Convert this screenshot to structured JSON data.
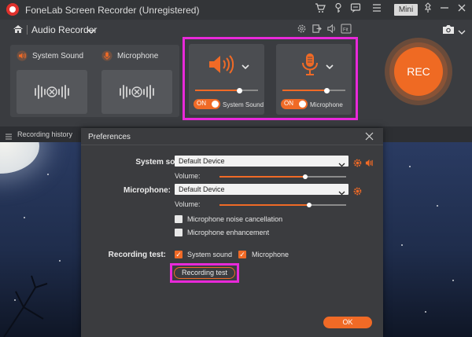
{
  "titlebar": {
    "app_title": "FoneLab Screen Recorder (Unregistered)",
    "mini_label": "Mini",
    "icons": [
      "cart-icon",
      "key-icon",
      "chat-icon",
      "menu-icon",
      "pin-icon",
      "minimize-icon",
      "close-icon"
    ]
  },
  "toolbar": {
    "mode_label": "Audio Recorder",
    "icons": [
      "settings-icon",
      "export-icon",
      "volume-icon",
      "fit-icon",
      "camera-icon"
    ]
  },
  "sources": {
    "system_sound_label": "System Sound",
    "microphone_label": "Microphone"
  },
  "controls": {
    "system": {
      "toggle": "ON",
      "label": "System Sound",
      "volume": 0.7
    },
    "microphone": {
      "toggle": "ON",
      "label": "Microphone",
      "volume": 0.7
    }
  },
  "rec_label": "REC",
  "history_label": "Recording history",
  "dialog": {
    "title": "Preferences",
    "system_sound_label": "System sound:",
    "system_device": "Default Device",
    "system_volume_label": "Volume:",
    "system_volume": 0.68,
    "microphone_label": "Microphone:",
    "mic_device": "Default Device",
    "mic_volume_label": "Volume:",
    "mic_volume": 0.71,
    "noise_cancel_label": "Microphone noise cancellation",
    "enhance_label": "Microphone enhancement",
    "recording_test_label": "Recording test:",
    "test_system_label": "System sound",
    "test_mic_label": "Microphone",
    "recording_test_button": "Recording test",
    "ok_button": "OK"
  },
  "colors": {
    "accent": "#f06a26",
    "highlight": "#e829d9"
  }
}
